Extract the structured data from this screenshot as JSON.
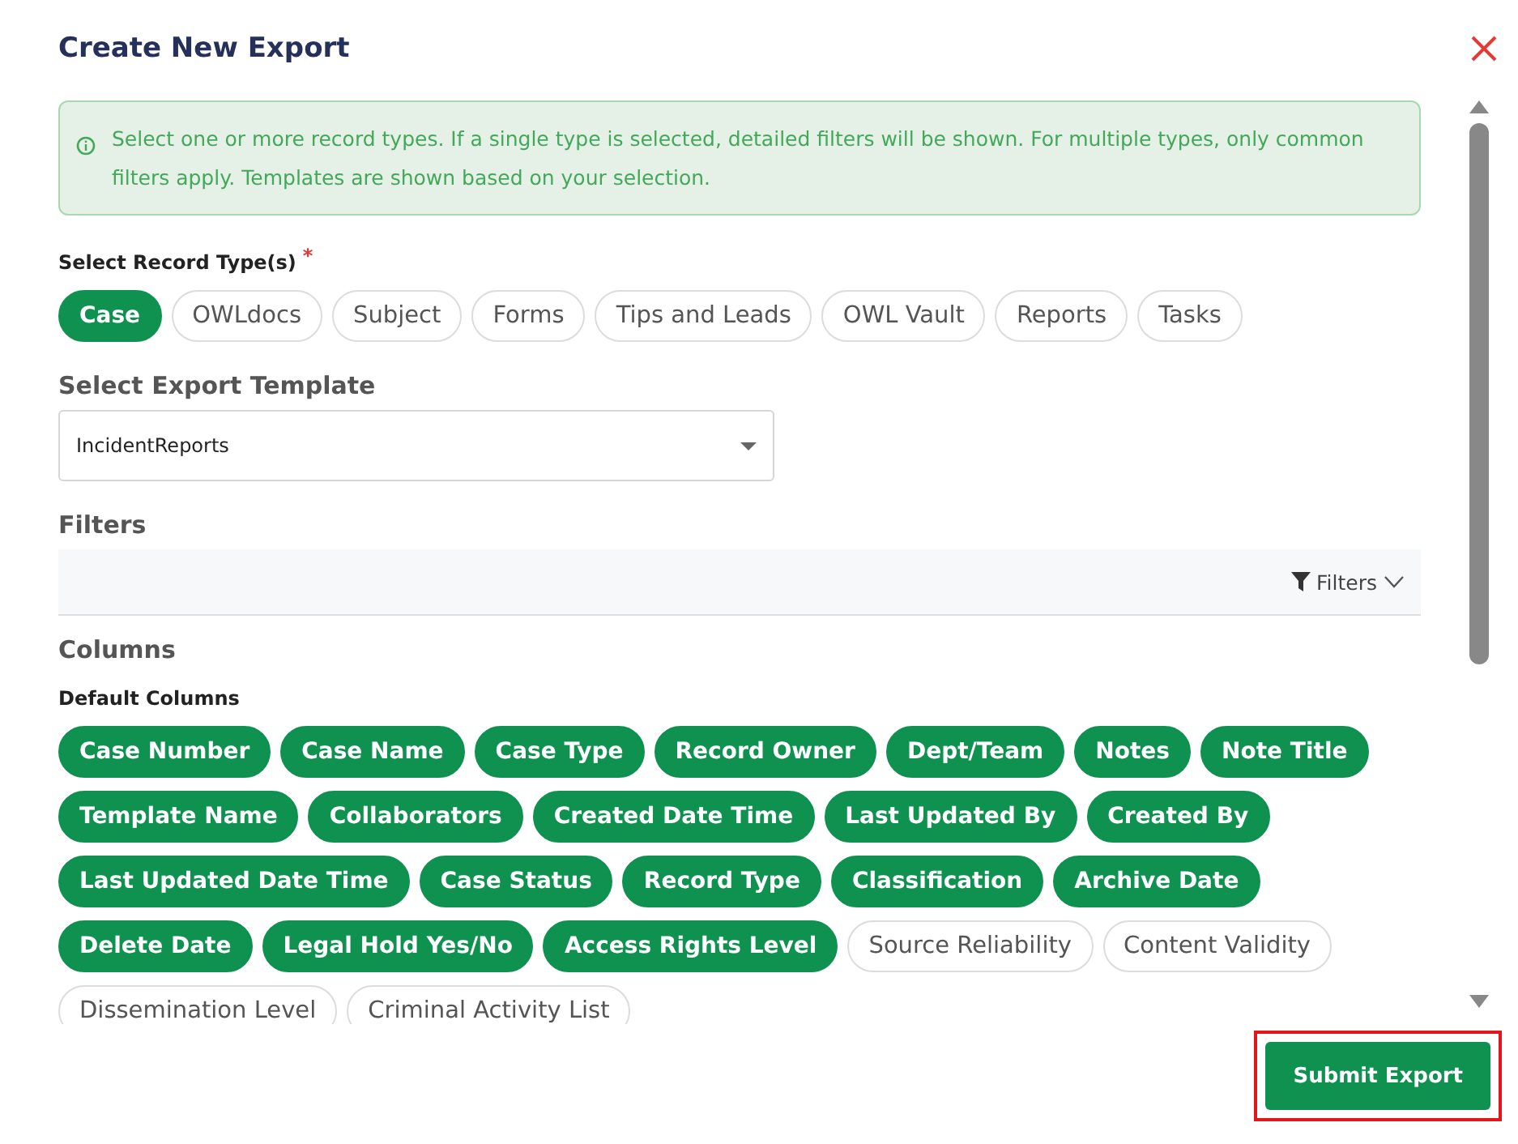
{
  "dialog": {
    "title": "Create New Export"
  },
  "info": "Select one or more record types. If a single type is selected, detailed filters will be shown. For multiple types, only common filters apply. Templates are shown based on your selection.",
  "record_types": {
    "label": "Select Record Type(s)",
    "required_mark": "*",
    "options": [
      {
        "label": "Case",
        "selected": true
      },
      {
        "label": "OWLdocs",
        "selected": false
      },
      {
        "label": "Subject",
        "selected": false
      },
      {
        "label": "Forms",
        "selected": false
      },
      {
        "label": "Tips and Leads",
        "selected": false
      },
      {
        "label": "OWL Vault",
        "selected": false
      },
      {
        "label": "Reports",
        "selected": false
      },
      {
        "label": "Tasks",
        "selected": false
      }
    ]
  },
  "template": {
    "label": "Select Export Template",
    "value": "IncidentReports"
  },
  "filters": {
    "heading": "Filters",
    "toggle": "Filters"
  },
  "columns": {
    "heading": "Columns",
    "subheading": "Default Columns",
    "items": [
      {
        "label": "Case Number",
        "selected": true
      },
      {
        "label": "Case Name",
        "selected": true
      },
      {
        "label": "Case Type",
        "selected": true
      },
      {
        "label": "Record Owner",
        "selected": true
      },
      {
        "label": "Dept/Team",
        "selected": true
      },
      {
        "label": "Notes",
        "selected": true
      },
      {
        "label": "Note Title",
        "selected": true
      },
      {
        "label": "Template Name",
        "selected": true
      },
      {
        "label": "Collaborators",
        "selected": true
      },
      {
        "label": "Created Date Time",
        "selected": true
      },
      {
        "label": "Last Updated By",
        "selected": true
      },
      {
        "label": "Created By",
        "selected": true
      },
      {
        "label": "Last Updated Date Time",
        "selected": true
      },
      {
        "label": "Case Status",
        "selected": true
      },
      {
        "label": "Record Type",
        "selected": true
      },
      {
        "label": "Classification",
        "selected": true
      },
      {
        "label": "Archive Date",
        "selected": true
      },
      {
        "label": "Delete Date",
        "selected": true
      },
      {
        "label": "Legal Hold Yes/No",
        "selected": true
      },
      {
        "label": "Access Rights Level",
        "selected": true
      },
      {
        "label": "Source Reliability",
        "selected": false
      },
      {
        "label": "Content Validity",
        "selected": false
      },
      {
        "label": "Dissemination Level",
        "selected": false
      },
      {
        "label": "Criminal Activity List",
        "selected": false
      }
    ]
  },
  "submit": {
    "label": "Submit Export",
    "highlighted": true
  }
}
